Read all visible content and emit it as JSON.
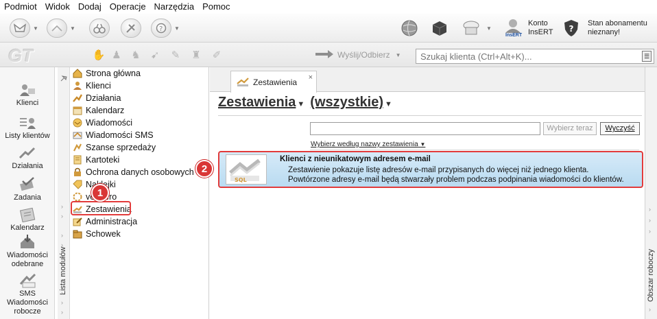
{
  "menu": [
    "Podmiot",
    "Widok",
    "Dodaj",
    "Operacje",
    "Narzędzia",
    "Pomoc"
  ],
  "toolbar": {
    "account_label_1": "Konto",
    "account_label_2": "InsERT",
    "account_logo": "InsERT",
    "subscription_line1": "Stan abonamentu",
    "subscription_line2": "nieznany!"
  },
  "toolbar2": {
    "logo": "GT",
    "send_receive": "Wyślij/Odbierz",
    "search_placeholder": "Szukaj klienta (Ctrl+Alt+K)..."
  },
  "leftbar": {
    "items": [
      {
        "label": "Klienci",
        "icon": "clients-icon"
      },
      {
        "label": "Listy klientów",
        "icon": "client-lists-icon"
      },
      {
        "label": "Działania",
        "icon": "actions-icon"
      },
      {
        "label": "Zadania",
        "icon": "tasks-icon"
      },
      {
        "label": "Kalendarz",
        "icon": "calendar-icon"
      },
      {
        "label": "Wiadomości odebrane",
        "icon": "inbox-icon"
      },
      {
        "label": "SMS Wiadomości robocze",
        "icon": "sms-drafts-icon"
      }
    ],
    "sms_tag": "SMS"
  },
  "modules": {
    "strip_label": "Lista modułów",
    "items": [
      "Strona główna",
      "Klienci",
      "Działania",
      "Kalendarz",
      "Wiadomości",
      "Wiadomości SMS",
      "Szanse sprzedaży",
      "Kartoteki",
      "Ochrona danych osobowych",
      "Naklejki",
      "vendero",
      "Zestawienia",
      "Administracja",
      "Schowek"
    ]
  },
  "content": {
    "tab_label": "Zestawienia",
    "tab_close": "×",
    "heading_1": "Zestawienia",
    "heading_2": "(wszystkie)",
    "filter_value": "",
    "btn_choose": "Wybierz teraz",
    "btn_clear": "Wyczyść",
    "sort_label": "Wybierz według nazwy zestawienia",
    "report": {
      "title": "Klienci z nieunikatowym adresem e-mail",
      "desc1": "Zestawienie pokazuje listę adresów e-mail przypisanych do więcej niż jednego klienta.",
      "desc2": "Powtórzone adresy e-mail będą stwarzały problem podczas podpinania wiadomości do klientów.",
      "thumb_tag": "SQL"
    }
  },
  "right_strip_label": "Obszar roboczy",
  "callouts": {
    "one": "1",
    "two": "2"
  },
  "colors": {
    "highlight": "#e23b3b",
    "card_bg": "#c6e2f5"
  }
}
